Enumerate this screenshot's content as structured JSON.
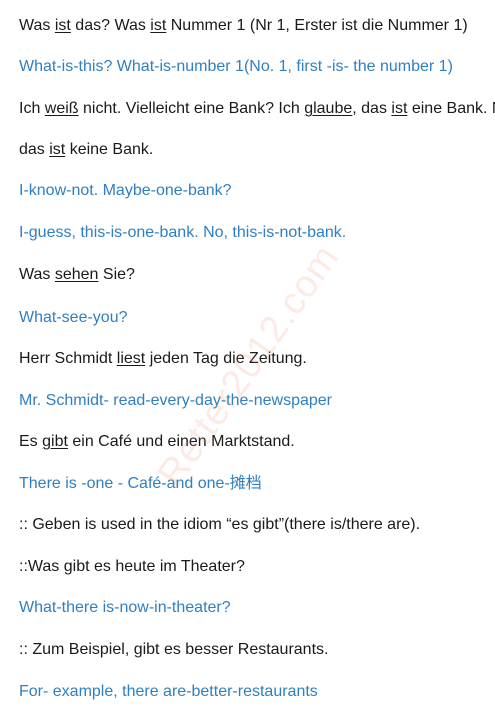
{
  "lines": [
    {
      "color": "dark",
      "segments": [
        "Was ",
        "ist",
        " das? Was ",
        "ist",
        " Nummer 1 (Nr 1, Erster ist die Nummer 1)"
      ]
    },
    {
      "color": "blue",
      "text": "What-is-this? What-is-number 1(No. 1, first -is- the number 1)"
    },
    {
      "color": "dark",
      "segments": [
        "Ich ",
        "weiß",
        " nicht. Vielleicht eine Bank? Ich ",
        "glaube",
        ", das ",
        "ist",
        " eine Bank. Nein,"
      ]
    },
    {
      "color": "dark",
      "segments": [
        "das ",
        "ist",
        " keine Bank."
      ]
    },
    {
      "color": "blue",
      "text": "I-know-not. Maybe-one-bank?"
    },
    {
      "color": "blue",
      "text": "I-guess, this-is-one-bank. No, this-is-not-bank."
    },
    {
      "color": "dark",
      "segments": [
        "Was ",
        "sehen",
        " Sie?"
      ]
    },
    {
      "color": "blue",
      "text": "What-see-you?"
    },
    {
      "color": "dark",
      "segments": [
        "Herr Schmidt ",
        "liest",
        " jeden Tag die Zeitung."
      ]
    },
    {
      "color": "blue",
      "text": "Mr. Schmidt- read-every-day-the-newspaper"
    },
    {
      "color": "dark",
      "segments": [
        "Es ",
        "gibt",
        " ein Café und einen Marktstand."
      ]
    },
    {
      "color": "blue",
      "text": "There is -one - Café-and one-摊档"
    },
    {
      "color": "dark",
      "text": ":: Geben is used in the idiom “es gibt”(there is/there are)."
    },
    {
      "color": "dark",
      "text": "::Was gibt es heute im Theater?"
    },
    {
      "color": "blue",
      "text": "What-there is-now-in-theater?"
    },
    {
      "color": "dark",
      "text": ":: Zum Beispiel, gibt es besser Restaurants."
    },
    {
      "color": "blue",
      "text": "For- example, there are-better-restaurants"
    }
  ],
  "watermark": "Retter2012.com",
  "colors": {
    "dark": "#1a1a1a",
    "blue": "#2f7fc2"
  }
}
